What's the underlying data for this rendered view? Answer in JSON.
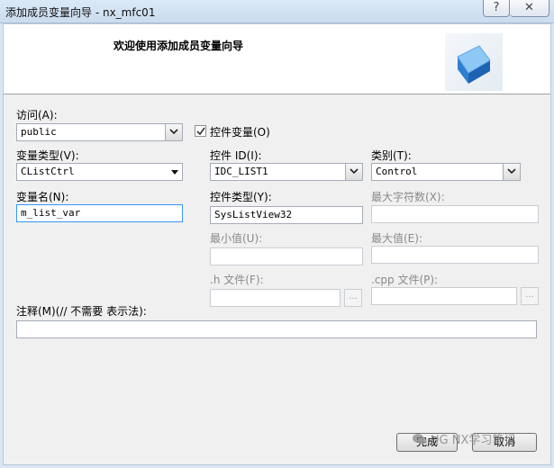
{
  "window": {
    "title": "添加成员变量向导 - nx_mfc01",
    "help_glyph": "?",
    "close_glyph": "✕"
  },
  "header": {
    "title": "欢迎使用添加成员变量向导"
  },
  "form": {
    "access_label": "访问(A):",
    "access_value": "public",
    "control_var_label": "控件变量(O)",
    "control_var_checked": true,
    "var_type_label": "变量类型(V):",
    "var_type_value": "CListCtrl",
    "control_id_label": "控件 ID(I):",
    "control_id_value": "IDC_LIST1",
    "category_label": "类别(T):",
    "category_value": "Control",
    "var_name_label": "变量名(N):",
    "var_name_value": "m_list_var",
    "control_type_label": "控件类型(Y):",
    "control_type_value": "SysListView32",
    "max_chars_label": "最大字符数(X):",
    "min_value_label": "最小值(U):",
    "max_value_label": "最大值(E):",
    "h_file_label": ".h 文件(F):",
    "cpp_file_label": ".cpp 文件(P):",
    "browse_label": "...",
    "comment_label": "注释(M)(// 不需要 表示法):",
    "comment_value": ""
  },
  "buttons": {
    "finish_label": "完成",
    "cancel_label": "取消"
  },
  "watermark": {
    "text": "UG NX学习笔记"
  }
}
